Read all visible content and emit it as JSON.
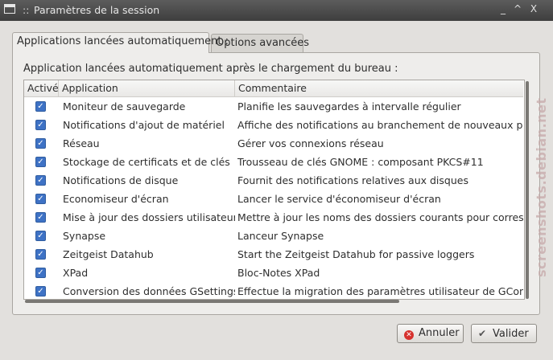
{
  "window": {
    "title": "Paramètres de la session",
    "grip": "::",
    "controls": [
      "_",
      "^",
      "X"
    ]
  },
  "tabs": [
    {
      "label": "Applications lancées automatiquement :",
      "active": true
    },
    {
      "label": "Options avancées",
      "active": false
    }
  ],
  "panel": {
    "description": "Application lancées automatiquement après le chargement du bureau :"
  },
  "table": {
    "headers": [
      "Activé",
      "Application",
      "Commentaire"
    ],
    "rows": [
      {
        "enabled": true,
        "app": "Moniteur de sauvegarde",
        "comment": "Planifie les sauvegardes à intervalle régulier"
      },
      {
        "enabled": true,
        "app": "Notifications d'ajout de matériel",
        "comment": "Affiche des notifications au branchement de nouveaux périp"
      },
      {
        "enabled": true,
        "app": "Réseau",
        "comment": "Gérer vos connexions réseau"
      },
      {
        "enabled": true,
        "app": "Stockage de certificats et de clés",
        "comment": "Trousseau de clés GNOME : composant PKCS#11"
      },
      {
        "enabled": true,
        "app": "Notifications de disque",
        "comment": "Fournit des notifications relatives aux disques"
      },
      {
        "enabled": true,
        "app": "Economiseur d'écran",
        "comment": "Lancer le service d'économiseur d'écran"
      },
      {
        "enabled": true,
        "app": "Mise à jour des dossiers utilisateur",
        "comment": "Mettre à jour les noms des dossiers courants pour correspon"
      },
      {
        "enabled": true,
        "app": "Synapse",
        "comment": "Lanceur Synapse"
      },
      {
        "enabled": true,
        "app": "Zeitgeist Datahub",
        "comment": "Start the Zeitgeist Datahub for passive loggers"
      },
      {
        "enabled": true,
        "app": "XPad",
        "comment": "Bloc-Notes XPad"
      },
      {
        "enabled": true,
        "app": "Conversion des données GSettings",
        "comment": "Effectue la migration des paramètres utilisateur de GConf ver"
      }
    ]
  },
  "buttons": {
    "cancel_label": "Annuler",
    "ok_label": "Valider"
  },
  "watermark": "screenshots.debian.net",
  "colors": {
    "titlebar": "#4a4a4a",
    "checkbox": "#3e72c5",
    "cancel_icon": "#d6322e"
  },
  "icons": {
    "window": "window-icon",
    "cancel": "cancel-icon",
    "ok": "checkmark-icon"
  }
}
